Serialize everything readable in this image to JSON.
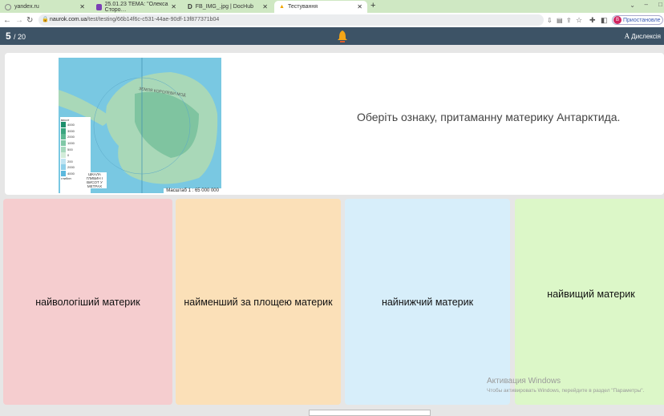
{
  "browser": {
    "tabs": [
      {
        "label": "yandex.ru",
        "active": false
      },
      {
        "label": "25.01.23 ТЕМА: \"Олекса Сторо…",
        "active": false
      },
      {
        "label": "FB_IMG_.jpg | DocHub",
        "active": false
      },
      {
        "label": "Тестування",
        "active": true
      }
    ],
    "url_host": "naurok.com.ua",
    "url_path": "/test/testing/66b14f6c-c531-44ae-90df-13f877371b04",
    "profile_initial": "В",
    "profile_status": "Приостановле"
  },
  "header": {
    "current": "5",
    "total": "/ 20",
    "dyslexia_label": "Дислексія"
  },
  "question": {
    "text": "Оберіть ознаку, притаманну материку Антарктида.",
    "map": {
      "legend_top": "висот",
      "legend_values": [
        "4000",
        "3000",
        "2000",
        "1000",
        "500",
        "0",
        "200",
        "2000",
        "4000"
      ],
      "legend_bottom": "глибин",
      "legend_caption": "ШКАЛА ГЛИБИН І ВИСОТ У МЕТРАХ",
      "label_land": "ЗЕМЛЯ КОРОЛЕВИ МОД",
      "scale": "Масштаб 1 : 65 000 000"
    }
  },
  "answers": [
    {
      "label": "найвологіший материк",
      "color": "#f5cdcf"
    },
    {
      "label": "найменший за площею материк",
      "color": "#fbe0b8"
    },
    {
      "label": "найнижчий материк",
      "color": "#d7eefa"
    },
    {
      "label": "найвищий материк",
      "color": "#dcf7c8"
    }
  ],
  "watermark": {
    "title": "Активация Windows",
    "text": "Чтобы активировать Windows, перейдите в раздел \"Параметры\"."
  }
}
